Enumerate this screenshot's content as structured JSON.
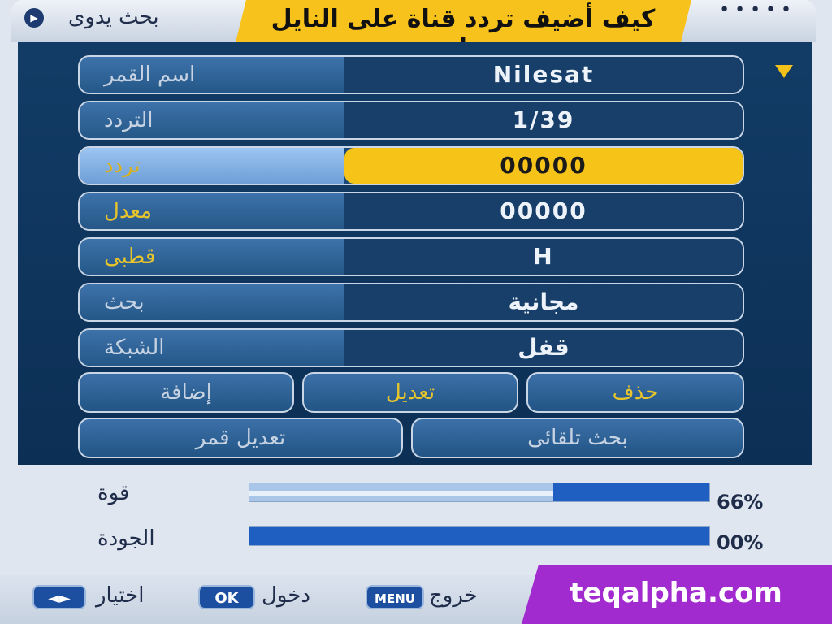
{
  "header": {
    "title": "بحث يدوى",
    "dots": "•••••",
    "banner": "كيف أضيف تردد قناة على النايل سات"
  },
  "rows": [
    {
      "label": "اسم القمر",
      "value": "Nilesat"
    },
    {
      "label": "التردد",
      "value": "1/39"
    },
    {
      "label": "تردد",
      "value": "00000"
    },
    {
      "label": "معدل",
      "value": "00000"
    },
    {
      "label": "قطبى",
      "value": "H"
    },
    {
      "label": "بحث",
      "value": "مجانية"
    },
    {
      "label": "الشبكة",
      "value": "قفل"
    }
  ],
  "buttons": {
    "add": "إضافة",
    "edit": "تعديل",
    "delete": "حذف",
    "edit_sat": "تعديل قمر",
    "auto_search": "بحث تلقائى"
  },
  "signal": {
    "strength_label": "قوة",
    "strength_pct": "66%",
    "strength_value": 66,
    "quality_label": "الجودة",
    "quality_pct": "00%",
    "quality_value": 0
  },
  "footer": {
    "select_key": "◄►",
    "select_label": "اختيار",
    "ok_key": "OK",
    "ok_label": "دخول",
    "menu_key": "MENU",
    "menu_label": "خروج"
  },
  "promo": "teqalpha.com",
  "colors": {
    "accent": "#f6c419",
    "panel": "#123c66",
    "promo": "#a22bd0"
  }
}
